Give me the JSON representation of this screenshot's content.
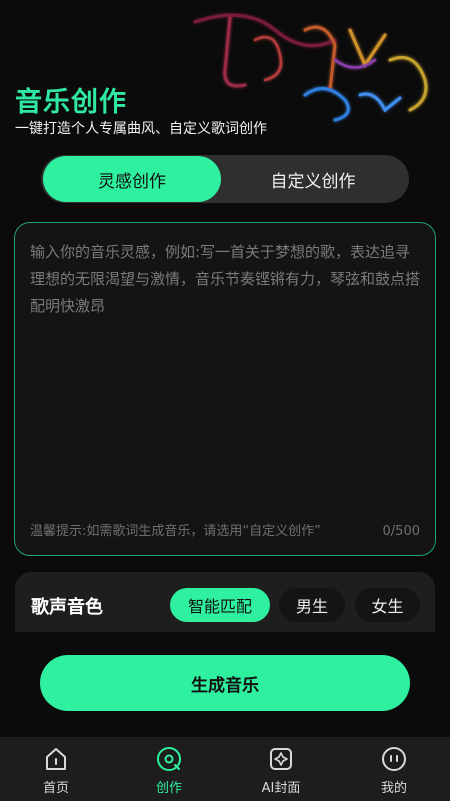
{
  "header": {
    "title": "音乐创作",
    "subtitle": "一键打造个人专属曲风、自定义歌词创作"
  },
  "mode_tabs": [
    {
      "label": "灵感创作",
      "active": true
    },
    {
      "label": "自定义创作",
      "active": false
    }
  ],
  "editor": {
    "placeholder": "输入你的音乐灵感，例如:写一首关于梦想的歌，表达追寻理想的无限渴望与激情，音乐节奏铿锵有力，琴弦和鼓点搭配明快激昂",
    "value": "",
    "hint": "温馨提示:如需歌词生成音乐，请选用“自定义创作”",
    "counter": "0/500"
  },
  "voice": {
    "label": "歌声音色",
    "options": [
      {
        "label": "智能匹配",
        "active": true
      },
      {
        "label": "男生",
        "active": false
      },
      {
        "label": "女生",
        "active": false
      }
    ]
  },
  "generate_label": "生成音乐",
  "nav": {
    "items": [
      {
        "label": "首页",
        "icon": "home-icon",
        "active": false
      },
      {
        "label": "创作",
        "icon": "disc-icon",
        "active": true
      },
      {
        "label": "AI封面",
        "icon": "ai-cover-icon",
        "active": false
      },
      {
        "label": "我的",
        "icon": "profile-icon",
        "active": false
      }
    ]
  },
  "colors": {
    "accent": "#2ff09f",
    "background": "#0b0b0b",
    "card": "#1e1e1e",
    "nav_background": "#1d1d1d"
  }
}
